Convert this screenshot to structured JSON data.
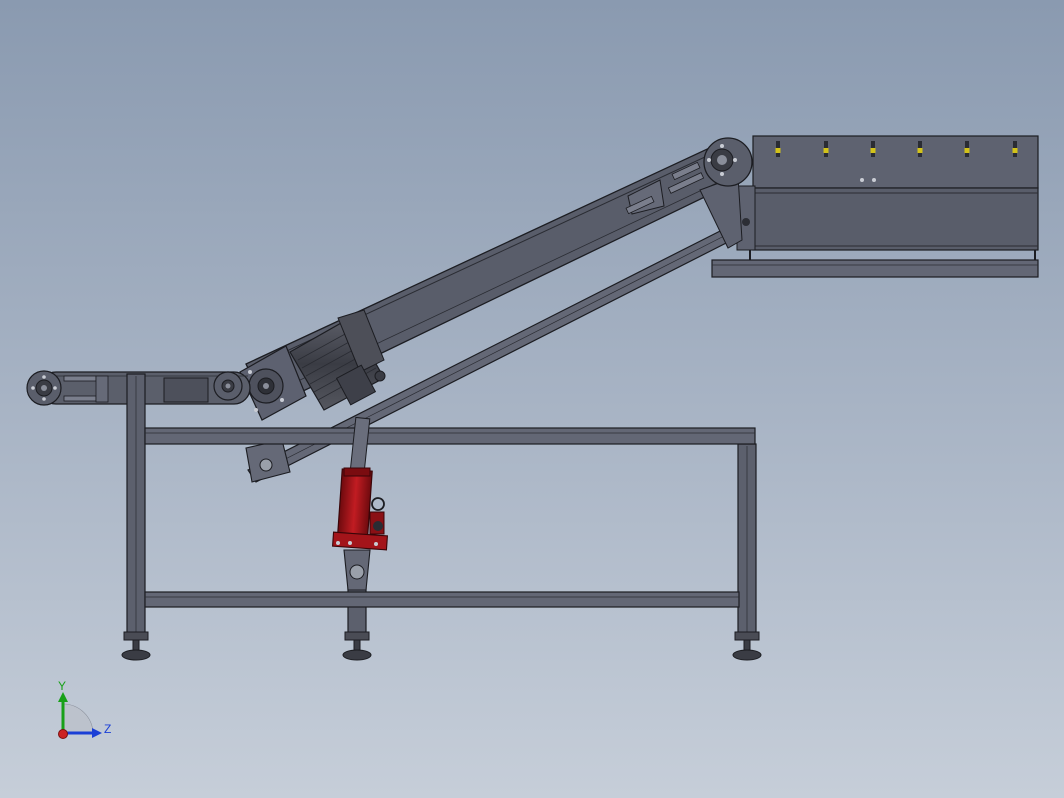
{
  "triad": {
    "y_label": "Y",
    "z_label": "Z",
    "colors": {
      "y": "#18a018",
      "z": "#1a3fd6",
      "x": "#cc2222"
    }
  },
  "colors": {
    "steel": "#5b5f6b",
    "steel_dark": "#3c3f48",
    "steel_light": "#6d7180",
    "outline": "#1c1d22",
    "cylinder_red": "#a3141a",
    "motor": "#4a4c55",
    "indicator_yellow": "#d2c21a"
  }
}
